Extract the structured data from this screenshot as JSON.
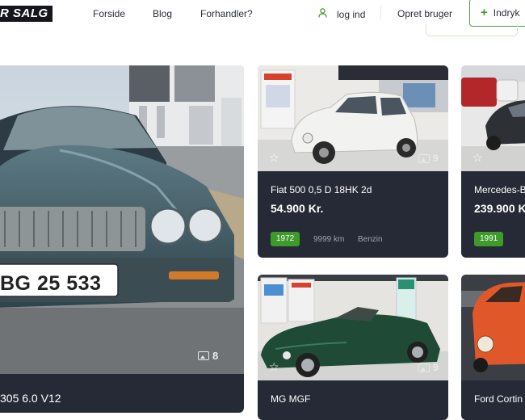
{
  "logo": {
    "text": "R SALG"
  },
  "nav": {
    "items": [
      "Forside",
      "Blog",
      "Forhandler?"
    ]
  },
  "header": {
    "login_label": "log ind",
    "signup_label": "Opret bruger",
    "cta_label": "Indryk"
  },
  "featured": {
    "title": "305 6.0 V12",
    "plate": "BG 25 533",
    "photo_count": "8"
  },
  "cards": [
    {
      "title": "Fiat 500 0,5 D 18HK 2d",
      "price": "54.900 Kr.",
      "year": "1972",
      "mileage": "9999 km",
      "fuel": "Benzin",
      "photo_count": "9"
    },
    {
      "title": "Mercedes-B",
      "price": "239.900 K",
      "year": "1991"
    },
    {
      "title": "MG MGF",
      "photo_count": "9"
    },
    {
      "title": "Ford Cortin"
    }
  ],
  "colors": {
    "accent": "#3d9a2b",
    "card_bg": "#262a36"
  }
}
